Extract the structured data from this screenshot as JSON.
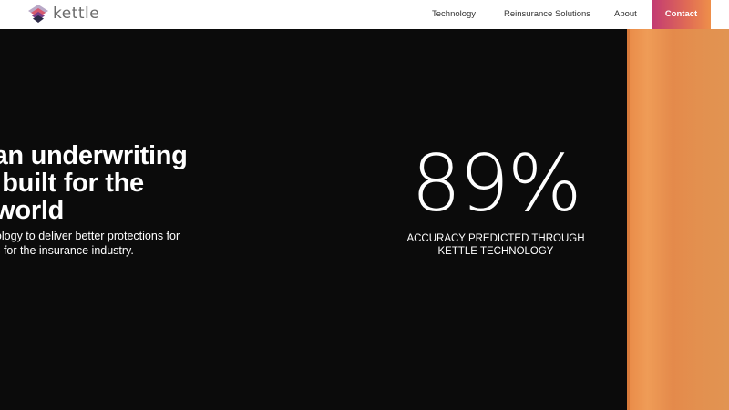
{
  "brand": {
    "name": "kettle",
    "logo_icon": "kettle-logo-icon",
    "colors": {
      "accent_start": "#c23a73",
      "accent_end": "#ee8f4a",
      "panel": "#e8904c",
      "background": "#0b0b0b"
    }
  },
  "nav": {
    "items": [
      {
        "label": "Technology"
      },
      {
        "label": "Reinsurance Solutions"
      },
      {
        "label": "About"
      }
    ],
    "contact_label": "Contact"
  },
  "hero": {
    "headline_lines": [
      "s an underwriting",
      "m built for the",
      "n world"
    ],
    "sub_lines": [
      "aking technology to deliver better protections for",
      "table returns for the insurance industry."
    ]
  },
  "stat": {
    "value": "89%",
    "caption_lines": [
      "ACCURACY PREDICTED THROUGH",
      "KETTLE TECHNOLOGY"
    ]
  }
}
